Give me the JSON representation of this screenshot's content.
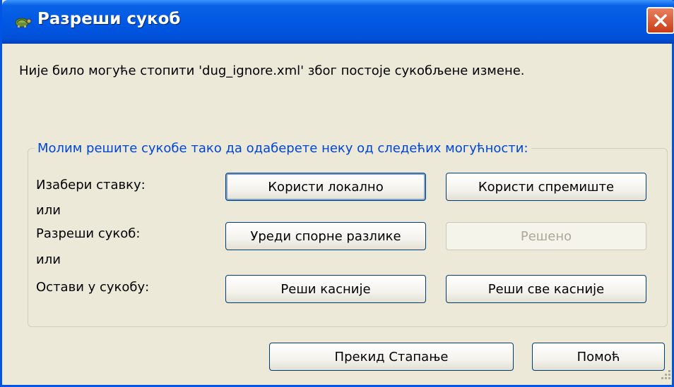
{
  "window": {
    "title": "Разреши сукоб"
  },
  "message": "Није било могуће стопити 'dug_ignore.xml' због постоје сукобљене измене.",
  "group": {
    "legend": "Молим решите сукобе тако да одаберете неку од следећих могућности:",
    "rows": [
      {
        "label": "Изабери ставку:"
      },
      {
        "separator": "или"
      },
      {
        "label": "Разреши сукоб:"
      },
      {
        "separator": "или"
      },
      {
        "label": "Остави у сукобу:"
      }
    ],
    "buttons": {
      "use_local": "Користи локално",
      "use_repo": "Користи спремиште",
      "edit_conflicts": "Уреди спорне разлике",
      "resolved": "Решено",
      "resolve_later": "Реши касније",
      "resolve_all_later": "Реши све касније"
    }
  },
  "footer": {
    "abort_merge": "Прекид Стапање",
    "help": "Помоћ"
  },
  "icons": {
    "app": "tortoise-icon",
    "close": "close-icon",
    "grip": "resize-grip-icon"
  },
  "colors": {
    "titlebar": "#0058e3",
    "legend_text": "#0046d5",
    "close_button": "#d65a36",
    "dialog_background": "#ece9d8"
  }
}
